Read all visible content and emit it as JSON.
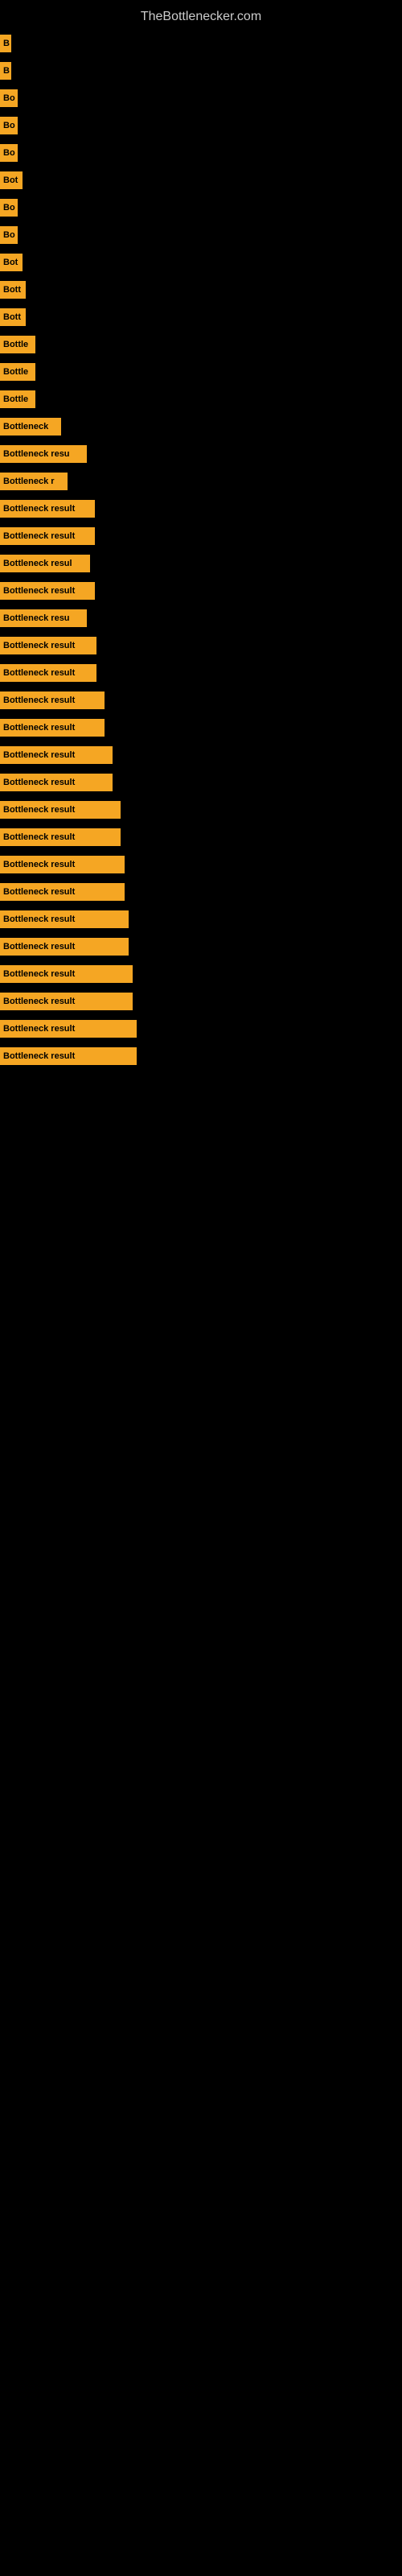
{
  "site": {
    "title": "TheBottlenecker.com"
  },
  "bars": [
    {
      "label": "B",
      "width": 14
    },
    {
      "label": "B",
      "width": 14
    },
    {
      "label": "Bo",
      "width": 22
    },
    {
      "label": "Bo",
      "width": 22
    },
    {
      "label": "Bo",
      "width": 22
    },
    {
      "label": "Bot",
      "width": 28
    },
    {
      "label": "Bo",
      "width": 22
    },
    {
      "label": "Bo",
      "width": 22
    },
    {
      "label": "Bot",
      "width": 28
    },
    {
      "label": "Bott",
      "width": 32
    },
    {
      "label": "Bott",
      "width": 32
    },
    {
      "label": "Bottle",
      "width": 44
    },
    {
      "label": "Bottle",
      "width": 44
    },
    {
      "label": "Bottle",
      "width": 44
    },
    {
      "label": "Bottleneck",
      "width": 76
    },
    {
      "label": "Bottleneck resu",
      "width": 108
    },
    {
      "label": "Bottleneck r",
      "width": 84
    },
    {
      "label": "Bottleneck result",
      "width": 118
    },
    {
      "label": "Bottleneck result",
      "width": 118
    },
    {
      "label": "Bottleneck resul",
      "width": 112
    },
    {
      "label": "Bottleneck result",
      "width": 118
    },
    {
      "label": "Bottleneck resu",
      "width": 108
    },
    {
      "label": "Bottleneck result",
      "width": 120
    },
    {
      "label": "Bottleneck result",
      "width": 120
    },
    {
      "label": "Bottleneck result",
      "width": 130
    },
    {
      "label": "Bottleneck result",
      "width": 130
    },
    {
      "label": "Bottleneck result",
      "width": 140
    },
    {
      "label": "Bottleneck result",
      "width": 140
    },
    {
      "label": "Bottleneck result",
      "width": 150
    },
    {
      "label": "Bottleneck result",
      "width": 150
    },
    {
      "label": "Bottleneck result",
      "width": 155
    },
    {
      "label": "Bottleneck result",
      "width": 155
    },
    {
      "label": "Bottleneck result",
      "width": 160
    },
    {
      "label": "Bottleneck result",
      "width": 160
    },
    {
      "label": "Bottleneck result",
      "width": 165
    },
    {
      "label": "Bottleneck result",
      "width": 165
    },
    {
      "label": "Bottleneck result",
      "width": 170
    },
    {
      "label": "Bottleneck result",
      "width": 170
    }
  ]
}
